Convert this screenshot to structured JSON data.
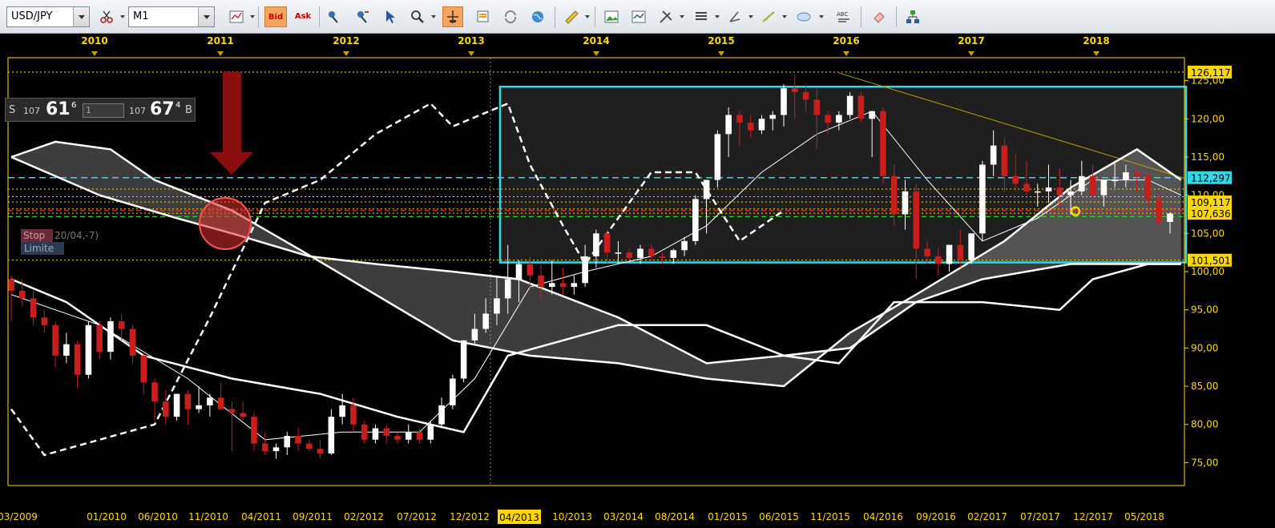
{
  "toolbar": {
    "symbol": "USD/JPY",
    "timeframe": "M1",
    "bid_label": "Bid",
    "ask_label": "Ask",
    "abc_label": "ABC",
    "icons": [
      "scissors-icon",
      "candles-icon",
      "bar-chart-icon",
      "order-icon",
      "trend-icon",
      "cursor-icon",
      "zoom-icon",
      "crosshair-icon",
      "notes-icon",
      "refresh-icon",
      "globe-icon",
      "ruler-icon",
      "picture-icon",
      "indicators-icon",
      "tools-icon",
      "lines-icon",
      "pencil-icon",
      "trendline-icon",
      "ellipse-icon",
      "text-icon",
      "eraser-icon",
      "tree-icon"
    ]
  },
  "price_panel": {
    "sell_label": "S",
    "sell_prefix": "107",
    "sell_big": "61",
    "sell_sup": "6",
    "quantity": "1",
    "buy_prefix": "107",
    "buy_big": "67",
    "buy_sup": "4",
    "buy_label": "B"
  },
  "order_label": {
    "stop": "Stop",
    "date": "20/04,-7)",
    "limit": "Limite"
  },
  "timeline": {
    "years": [
      "2010",
      "2011",
      "2012",
      "2013",
      "2014",
      "2015",
      "2016",
      "2017",
      "2018"
    ],
    "dates": [
      "03/2009",
      "01/2010",
      "06/2010",
      "11/2010",
      "04/2011",
      "09/2011",
      "02/2012",
      "07/2012",
      "12/2012",
      "04/2013",
      "10/2013",
      "03/2014",
      "08/2014",
      "01/2015",
      "06/2015",
      "11/2015",
      "04/2016",
      "09/2016",
      "02/2017",
      "07/2017",
      "12/2017",
      "05/2018"
    ],
    "cursor_date": "04/2013"
  },
  "axis": {
    "ticks": [
      "125,00",
      "120,00",
      "115,00",
      "110,00",
      "105,00",
      "100,00",
      "95,00",
      "90,00",
      "85,00",
      "80,00",
      "75,00"
    ],
    "price_labels": [
      {
        "price": "126,117",
        "color": "#ffd700"
      },
      {
        "price": "112,297",
        "color": "#35d7e6"
      },
      {
        "price": "109,117",
        "color": "#ffd700"
      },
      {
        "price": "107,636",
        "color": "#ffd700"
      },
      {
        "price": "101,501",
        "color": "#ffd700"
      }
    ]
  },
  "colors": {
    "up": "#ffffff",
    "down": "#c81e1e",
    "cloud": "#444444",
    "box": "#35d7e6",
    "grid_text": "#ffd700"
  },
  "chart_data": {
    "type": "candlestick",
    "title": "",
    "symbol": "USD/JPY",
    "timeframe": "M1",
    "ylim": [
      72,
      128
    ],
    "candles": [
      {
        "o": 99.0,
        "h": 99.5,
        "l": 93.5,
        "c": 97.5
      },
      {
        "o": 97.5,
        "h": 99.0,
        "l": 95.5,
        "c": 96.5
      },
      {
        "o": 96.5,
        "h": 97.5,
        "l": 93.0,
        "c": 94.0
      },
      {
        "o": 94.0,
        "h": 95.0,
        "l": 92.0,
        "c": 93.0
      },
      {
        "o": 93.0,
        "h": 93.5,
        "l": 87.5,
        "c": 89.0
      },
      {
        "o": 89.0,
        "h": 92.0,
        "l": 88.0,
        "c": 90.5
      },
      {
        "o": 90.5,
        "h": 91.0,
        "l": 84.8,
        "c": 86.5
      },
      {
        "o": 86.5,
        "h": 93.5,
        "l": 86.0,
        "c": 93.0
      },
      {
        "o": 93.0,
        "h": 93.5,
        "l": 88.5,
        "c": 89.5
      },
      {
        "o": 89.5,
        "h": 94.0,
        "l": 88.5,
        "c": 93.5
      },
      {
        "o": 93.5,
        "h": 94.5,
        "l": 91.0,
        "c": 92.5
      },
      {
        "o": 92.5,
        "h": 93.0,
        "l": 88.0,
        "c": 89.0
      },
      {
        "o": 89.0,
        "h": 89.5,
        "l": 84.0,
        "c": 85.5
      },
      {
        "o": 85.5,
        "h": 86.0,
        "l": 80.5,
        "c": 83.0
      },
      {
        "o": 83.0,
        "h": 84.5,
        "l": 80.0,
        "c": 81.0
      },
      {
        "o": 81.0,
        "h": 84.0,
        "l": 80.5,
        "c": 84.0
      },
      {
        "o": 84.0,
        "h": 84.5,
        "l": 80.0,
        "c": 82.0
      },
      {
        "o": 82.0,
        "h": 85.0,
        "l": 81.5,
        "c": 82.5
      },
      {
        "o": 82.5,
        "h": 84.0,
        "l": 81.0,
        "c": 83.5
      },
      {
        "o": 83.5,
        "h": 85.5,
        "l": 82.0,
        "c": 82.0
      },
      {
        "o": 82.0,
        "h": 83.0,
        "l": 76.5,
        "c": 81.5
      },
      {
        "o": 81.5,
        "h": 83.0,
        "l": 80.5,
        "c": 81.0
      },
      {
        "o": 81.0,
        "h": 81.5,
        "l": 76.5,
        "c": 77.5
      },
      {
        "o": 77.5,
        "h": 79.0,
        "l": 76.0,
        "c": 76.5
      },
      {
        "o": 76.5,
        "h": 77.5,
        "l": 75.5,
        "c": 77.0
      },
      {
        "o": 77.0,
        "h": 79.0,
        "l": 76.0,
        "c": 78.5
      },
      {
        "o": 78.5,
        "h": 79.5,
        "l": 76.5,
        "c": 77.5
      },
      {
        "o": 77.5,
        "h": 78.0,
        "l": 76.5,
        "c": 76.8
      },
      {
        "o": 76.8,
        "h": 78.0,
        "l": 75.5,
        "c": 76.2
      },
      {
        "o": 76.2,
        "h": 82.0,
        "l": 76.0,
        "c": 81.0
      },
      {
        "o": 81.0,
        "h": 84.0,
        "l": 80.0,
        "c": 82.5
      },
      {
        "o": 82.5,
        "h": 83.5,
        "l": 79.0,
        "c": 80.0
      },
      {
        "o": 80.0,
        "h": 80.5,
        "l": 77.5,
        "c": 78.0
      },
      {
        "o": 78.0,
        "h": 80.0,
        "l": 77.5,
        "c": 79.5
      },
      {
        "o": 79.5,
        "h": 80.0,
        "l": 77.5,
        "c": 78.5
      },
      {
        "o": 78.5,
        "h": 79.0,
        "l": 77.5,
        "c": 78.0
      },
      {
        "o": 78.0,
        "h": 80.0,
        "l": 77.5,
        "c": 79.0
      },
      {
        "o": 79.0,
        "h": 79.5,
        "l": 77.5,
        "c": 78.0
      },
      {
        "o": 78.0,
        "h": 80.5,
        "l": 77.5,
        "c": 80.0
      },
      {
        "o": 80.0,
        "h": 83.5,
        "l": 79.5,
        "c": 82.5
      },
      {
        "o": 82.5,
        "h": 86.5,
        "l": 82.0,
        "c": 86.0
      },
      {
        "o": 86.0,
        "h": 91.0,
        "l": 85.5,
        "c": 91.0
      },
      {
        "o": 91.0,
        "h": 94.5,
        "l": 90.5,
        "c": 92.5
      },
      {
        "o": 92.5,
        "h": 96.5,
        "l": 92.0,
        "c": 94.5
      },
      {
        "o": 94.5,
        "h": 99.5,
        "l": 93.0,
        "c": 96.5
      },
      {
        "o": 96.5,
        "h": 103.5,
        "l": 94.5,
        "c": 99.0
      },
      {
        "o": 99.0,
        "h": 101.5,
        "l": 96.0,
        "c": 101.0
      },
      {
        "o": 101.0,
        "h": 102.0,
        "l": 97.5,
        "c": 99.5
      },
      {
        "o": 99.5,
        "h": 101.0,
        "l": 96.5,
        "c": 98.0
      },
      {
        "o": 98.0,
        "h": 101.5,
        "l": 97.0,
        "c": 98.5
      },
      {
        "o": 98.5,
        "h": 100.5,
        "l": 97.0,
        "c": 98.0
      },
      {
        "o": 98.0,
        "h": 99.5,
        "l": 97.0,
        "c": 98.5
      },
      {
        "o": 98.5,
        "h": 103.5,
        "l": 98.0,
        "c": 102.0
      },
      {
        "o": 102.0,
        "h": 105.5,
        "l": 100.5,
        "c": 105.0
      },
      {
        "o": 105.0,
        "h": 105.5,
        "l": 101.0,
        "c": 102.5
      },
      {
        "o": 102.5,
        "h": 104.0,
        "l": 101.0,
        "c": 102.5
      },
      {
        "o": 102.5,
        "h": 103.0,
        "l": 101.5,
        "c": 101.8
      },
      {
        "o": 101.8,
        "h": 103.5,
        "l": 101.0,
        "c": 103.0
      },
      {
        "o": 103.0,
        "h": 103.5,
        "l": 101.5,
        "c": 102.0
      },
      {
        "o": 102.0,
        "h": 102.5,
        "l": 101.0,
        "c": 101.8
      },
      {
        "o": 101.8,
        "h": 103.0,
        "l": 101.0,
        "c": 102.8
      },
      {
        "o": 102.8,
        "h": 104.5,
        "l": 102.0,
        "c": 104.0
      },
      {
        "o": 104.0,
        "h": 110.0,
        "l": 103.5,
        "c": 109.5
      },
      {
        "o": 109.5,
        "h": 112.0,
        "l": 105.0,
        "c": 112.0
      },
      {
        "o": 112.0,
        "h": 118.5,
        "l": 111.0,
        "c": 118.0
      },
      {
        "o": 118.0,
        "h": 121.5,
        "l": 115.0,
        "c": 120.5
      },
      {
        "o": 120.5,
        "h": 121.0,
        "l": 116.5,
        "c": 119.5
      },
      {
        "o": 119.5,
        "h": 120.5,
        "l": 117.5,
        "c": 118.5
      },
      {
        "o": 118.5,
        "h": 120.5,
        "l": 118.0,
        "c": 120.0
      },
      {
        "o": 120.0,
        "h": 121.0,
        "l": 118.5,
        "c": 120.5
      },
      {
        "o": 120.5,
        "h": 124.5,
        "l": 119.0,
        "c": 124.0
      },
      {
        "o": 124.0,
        "h": 125.8,
        "l": 120.0,
        "c": 123.5
      },
      {
        "o": 123.5,
        "h": 124.5,
        "l": 121.0,
        "c": 122.5
      },
      {
        "o": 122.5,
        "h": 124.0,
        "l": 116.0,
        "c": 120.5
      },
      {
        "o": 120.5,
        "h": 121.0,
        "l": 118.0,
        "c": 119.5
      },
      {
        "o": 119.5,
        "h": 121.0,
        "l": 118.5,
        "c": 120.5
      },
      {
        "o": 120.5,
        "h": 123.5,
        "l": 120.0,
        "c": 123.0
      },
      {
        "o": 123.0,
        "h": 123.5,
        "l": 119.5,
        "c": 120.0
      },
      {
        "o": 120.0,
        "h": 121.0,
        "l": 115.0,
        "c": 121.0
      },
      {
        "o": 121.0,
        "h": 121.5,
        "l": 111.5,
        "c": 112.5
      },
      {
        "o": 112.5,
        "h": 114.0,
        "l": 106.0,
        "c": 107.5
      },
      {
        "o": 107.5,
        "h": 112.0,
        "l": 105.5,
        "c": 110.5
      },
      {
        "o": 110.5,
        "h": 111.5,
        "l": 99.0,
        "c": 103.0
      },
      {
        "o": 103.0,
        "h": 104.0,
        "l": 101.0,
        "c": 102.0
      },
      {
        "o": 102.0,
        "h": 103.0,
        "l": 99.5,
        "c": 101.0
      },
      {
        "o": 101.0,
        "h": 102.0,
        "l": 100.0,
        "c": 103.5
      },
      {
        "o": 103.5,
        "h": 105.5,
        "l": 100.5,
        "c": 101.5
      },
      {
        "o": 101.5,
        "h": 105.0,
        "l": 101.0,
        "c": 105.0
      },
      {
        "o": 105.0,
        "h": 114.5,
        "l": 104.0,
        "c": 114.0
      },
      {
        "o": 114.0,
        "h": 118.5,
        "l": 112.5,
        "c": 116.5
      },
      {
        "o": 116.5,
        "h": 117.5,
        "l": 110.5,
        "c": 112.5
      },
      {
        "o": 112.5,
        "h": 115.5,
        "l": 110.5,
        "c": 111.5
      },
      {
        "o": 111.5,
        "h": 114.5,
        "l": 110.0,
        "c": 110.5
      },
      {
        "o": 110.5,
        "h": 111.5,
        "l": 108.5,
        "c": 110.5
      },
      {
        "o": 110.5,
        "h": 114.0,
        "l": 109.0,
        "c": 111.0
      },
      {
        "o": 111.0,
        "h": 113.5,
        "l": 108.0,
        "c": 110.0
      },
      {
        "o": 110.0,
        "h": 112.0,
        "l": 107.5,
        "c": 110.5
      },
      {
        "o": 110.5,
        "h": 114.5,
        "l": 110.0,
        "c": 112.5
      },
      {
        "o": 112.5,
        "h": 114.0,
        "l": 107.5,
        "c": 110.0
      },
      {
        "o": 110.0,
        "h": 112.0,
        "l": 108.5,
        "c": 112.0
      },
      {
        "o": 112.0,
        "h": 114.5,
        "l": 111.0,
        "c": 112.0
      },
      {
        "o": 112.0,
        "h": 114.0,
        "l": 111.0,
        "c": 113.0
      },
      {
        "o": 113.0,
        "h": 113.5,
        "l": 110.5,
        "c": 112.5
      },
      {
        "o": 112.5,
        "h": 113.0,
        "l": 108.5,
        "c": 109.5
      },
      {
        "o": 109.5,
        "h": 110.5,
        "l": 106.0,
        "c": 106.5
      },
      {
        "o": 106.5,
        "h": 107.8,
        "l": 105.0,
        "c": 107.6
      }
    ],
    "ichimoku": {
      "tenkan": [
        [
          0,
          97
        ],
        [
          8,
          93
        ],
        [
          16,
          86
        ],
        [
          23,
          78
        ],
        [
          30,
          79
        ],
        [
          37,
          79
        ],
        [
          42,
          86
        ],
        [
          47,
          98
        ],
        [
          52,
          100
        ],
        [
          58,
          102
        ],
        [
          63,
          106
        ],
        [
          68,
          113
        ],
        [
          73,
          118
        ],
        [
          78,
          121
        ],
        [
          83,
          112
        ],
        [
          88,
          104
        ],
        [
          93,
          107
        ],
        [
          98,
          112
        ],
        [
          103,
          112
        ],
        [
          106,
          110
        ]
      ],
      "kijun": [
        [
          0,
          99
        ],
        [
          5,
          96
        ],
        [
          12,
          89
        ],
        [
          20,
          86
        ],
        [
          28,
          84
        ],
        [
          35,
          81
        ],
        [
          41,
          79
        ],
        [
          45,
          89
        ],
        [
          55,
          93
        ],
        [
          63,
          93
        ],
        [
          70,
          89
        ],
        [
          75,
          88
        ],
        [
          80,
          96
        ],
        [
          88,
          96
        ],
        [
          95,
          95
        ],
        [
          98,
          99
        ],
        [
          103,
          101
        ],
        [
          106,
          101
        ]
      ],
      "chikou": [
        [
          0,
          82
        ],
        [
          3,
          76
        ],
        [
          8,
          78
        ],
        [
          13,
          80
        ],
        [
          18,
          94
        ],
        [
          23,
          109
        ],
        [
          28,
          112
        ],
        [
          33,
          118
        ],
        [
          38,
          122
        ],
        [
          40,
          119
        ],
        [
          45,
          122
        ],
        [
          47,
          114
        ],
        [
          50,
          106
        ],
        [
          52,
          101
        ],
        [
          58,
          113
        ],
        [
          62,
          113
        ],
        [
          66,
          104
        ],
        [
          70,
          108
        ]
      ],
      "senkou_a": [
        [
          0,
          115
        ],
        [
          4,
          117
        ],
        [
          9,
          116
        ],
        [
          13,
          112
        ],
        [
          20,
          108
        ],
        [
          26,
          103
        ],
        [
          33,
          97
        ],
        [
          40,
          91
        ],
        [
          47,
          89
        ],
        [
          55,
          88
        ],
        [
          63,
          86
        ],
        [
          70,
          85
        ],
        [
          76,
          92
        ],
        [
          82,
          97
        ],
        [
          90,
          104
        ],
        [
          96,
          111
        ],
        [
          102,
          116
        ],
        [
          106,
          112
        ]
      ],
      "senkou_b": [
        [
          0,
          115
        ],
        [
          8,
          110
        ],
        [
          15,
          107
        ],
        [
          20,
          105
        ],
        [
          27,
          102
        ],
        [
          33,
          101
        ],
        [
          40,
          100
        ],
        [
          46,
          99
        ],
        [
          55,
          94
        ],
        [
          63,
          88
        ],
        [
          70,
          89
        ],
        [
          76,
          90
        ],
        [
          82,
          96
        ],
        [
          88,
          99
        ],
        [
          96,
          101
        ],
        [
          102,
          101
        ],
        [
          106,
          101
        ]
      ]
    },
    "levels": {
      "box_high": 124.2,
      "box_low": 101.2,
      "dashed_cyan": 112.297,
      "yellow_lines": [
        126.117,
        110.8,
        109.8,
        109.117,
        108.2,
        107.636,
        101.501
      ],
      "red_dashed": 108.0,
      "green_dashed": 107.2,
      "trendline_start": 126.0,
      "trendline_end": 112.2
    }
  }
}
